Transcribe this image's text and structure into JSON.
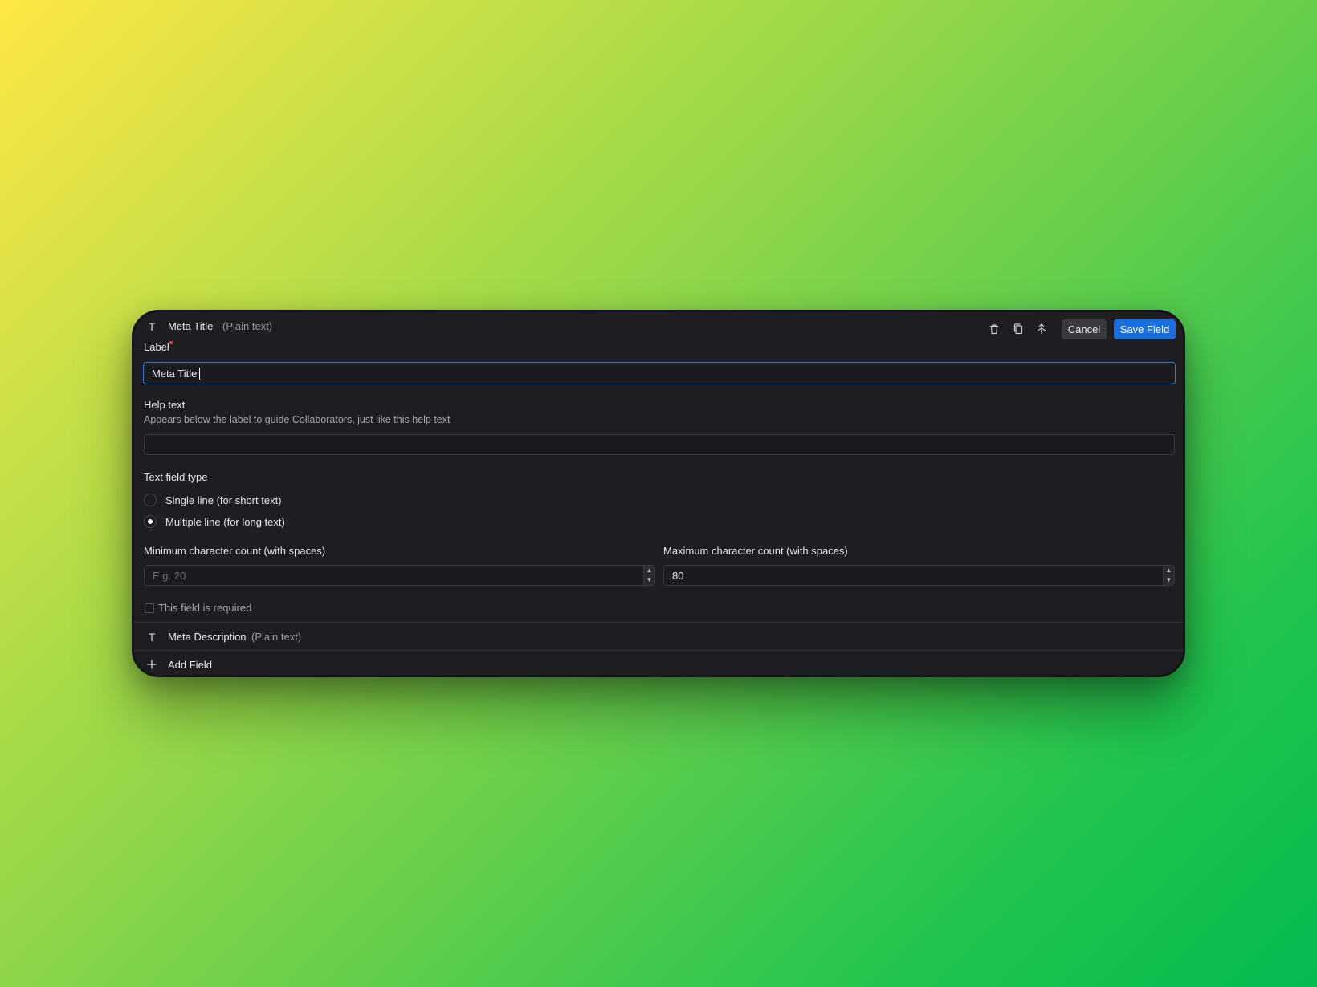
{
  "header": {
    "field_icon": "text-type-icon",
    "title": "Meta Title",
    "type": "(Plain text)",
    "tools": [
      "trash-icon",
      "duplicate-icon",
      "move-icon"
    ],
    "cancel_label": "Cancel",
    "save_label": "Save Field"
  },
  "label_field": {
    "label": "Label",
    "value": "Meta Title"
  },
  "help_field": {
    "label": "Help text",
    "description": "Appears below the label to guide Collaborators, just like this help text",
    "value": ""
  },
  "text_type": {
    "label": "Text field type",
    "options": [
      {
        "label": "Single line (for short text)",
        "selected": false
      },
      {
        "label": "Multiple line (for long text)",
        "selected": true
      }
    ]
  },
  "min_count": {
    "label": "Minimum character count (with spaces)",
    "placeholder": "E.g. 20",
    "value": ""
  },
  "max_count": {
    "label": "Maximum character count (with spaces)",
    "value": "80"
  },
  "required": {
    "label": "This field is required",
    "checked": false
  },
  "other_fields": [
    {
      "title": "Meta Description",
      "type": "(Plain text)",
      "icon": "text-type-icon"
    }
  ],
  "add_field": {
    "label": "Add Field",
    "icon": "plus-icon"
  },
  "colors": {
    "panel_bg": "#1e1d21",
    "accent": "#1a6fe0",
    "required_dot": "#ef3e3e"
  }
}
